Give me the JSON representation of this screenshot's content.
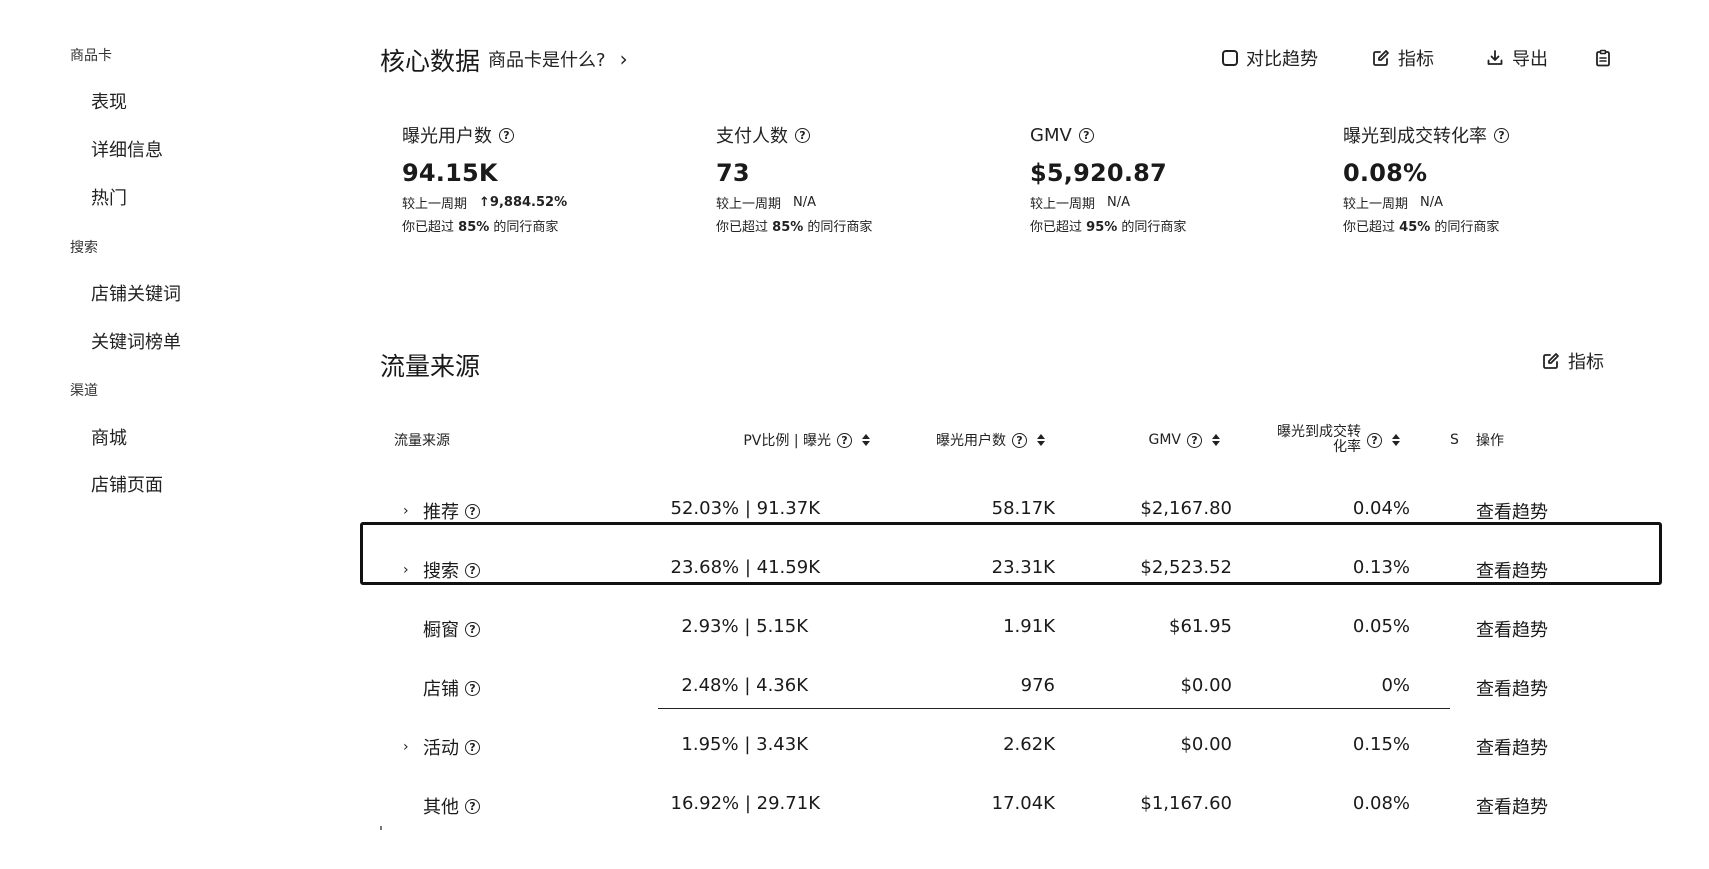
{
  "sidebar": {
    "groups": [
      {
        "label": "商品卡",
        "items": [
          {
            "label": "表现"
          },
          {
            "label": "详细信息"
          },
          {
            "label": "热门"
          }
        ]
      },
      {
        "label": "搜索",
        "items": [
          {
            "label": "店铺关键词"
          },
          {
            "label": "关键词榜单"
          }
        ]
      },
      {
        "label": "渠道",
        "items": [
          {
            "label": "商城"
          },
          {
            "label": "店铺页面"
          }
        ]
      }
    ]
  },
  "core": {
    "title": "核心数据",
    "help_link": "商品卡是什么?",
    "compare_label": "对比趋势",
    "metrics_label": "指标",
    "export_label": "导出"
  },
  "metrics": [
    {
      "label": "曝光用户数",
      "value": "94.15K",
      "compare_label": "较上一周期",
      "change": "9,884.52%",
      "rank_prefix": "你已超过",
      "rank_pct": "85%",
      "rank_suffix": "的同行商家"
    },
    {
      "label": "支付人数",
      "value": "73",
      "compare_label": "较上一周期",
      "change": "N/A",
      "rank_prefix": "你已超过",
      "rank_pct": "85%",
      "rank_suffix": "的同行商家"
    },
    {
      "label": "GMV",
      "value": "$5,920.87",
      "compare_label": "较上一周期",
      "change": "N/A",
      "rank_prefix": "你已超过",
      "rank_pct": "95%",
      "rank_suffix": "的同行商家"
    },
    {
      "label": "曝光到成交转化率",
      "value": "0.08%",
      "compare_label": "较上一周期",
      "change": "N/A",
      "rank_prefix": "你已超过",
      "rank_pct": "45%",
      "rank_suffix": "的同行商家"
    }
  ],
  "traffic": {
    "title": "流量来源",
    "metrics_label": "指标",
    "columns": {
      "source": "流量来源",
      "pv": "PV比例 | 曝光",
      "users": "曝光用户数",
      "gmv": "GMV",
      "conv_line1": "曝光到成交转",
      "conv_line2": "化率",
      "s": "S",
      "action": "操作"
    },
    "rows": [
      {
        "source": "推荐",
        "expandable": true,
        "pv": "52.03% | 91.37K",
        "users": "58.17K",
        "gmv": "$2,167.80",
        "conv": "0.04%",
        "action": "查看趋势"
      },
      {
        "source": "搜索",
        "expandable": true,
        "pv": "23.68% | 41.59K",
        "users": "23.31K",
        "gmv": "$2,523.52",
        "conv": "0.13%",
        "action": "查看趋势"
      },
      {
        "source": "橱窗",
        "expandable": false,
        "pv": "2.93% | 5.15K",
        "users": "1.91K",
        "gmv": "$61.95",
        "conv": "0.05%",
        "action": "查看趋势"
      },
      {
        "source": "店铺",
        "expandable": false,
        "pv": "2.48% | 4.36K",
        "users": "976",
        "gmv": "$0.00",
        "conv": "0%",
        "action": "查看趋势"
      },
      {
        "source": "活动",
        "expandable": true,
        "pv": "1.95% | 3.43K",
        "users": "2.62K",
        "gmv": "$0.00",
        "conv": "0.15%",
        "action": "查看趋势"
      },
      {
        "source": "其他",
        "expandable": false,
        "pv": "16.92% | 29.71K",
        "users": "17.04K",
        "gmv": "$1,167.60",
        "conv": "0.08%",
        "action": "查看趋势"
      }
    ]
  },
  "icons": {
    "help": "question-circle-icon",
    "expand": "chevron-right-icon",
    "edit": "edit-icon",
    "export": "download-icon",
    "clipboard": "clipboard-icon",
    "sort": "sort-icon"
  }
}
